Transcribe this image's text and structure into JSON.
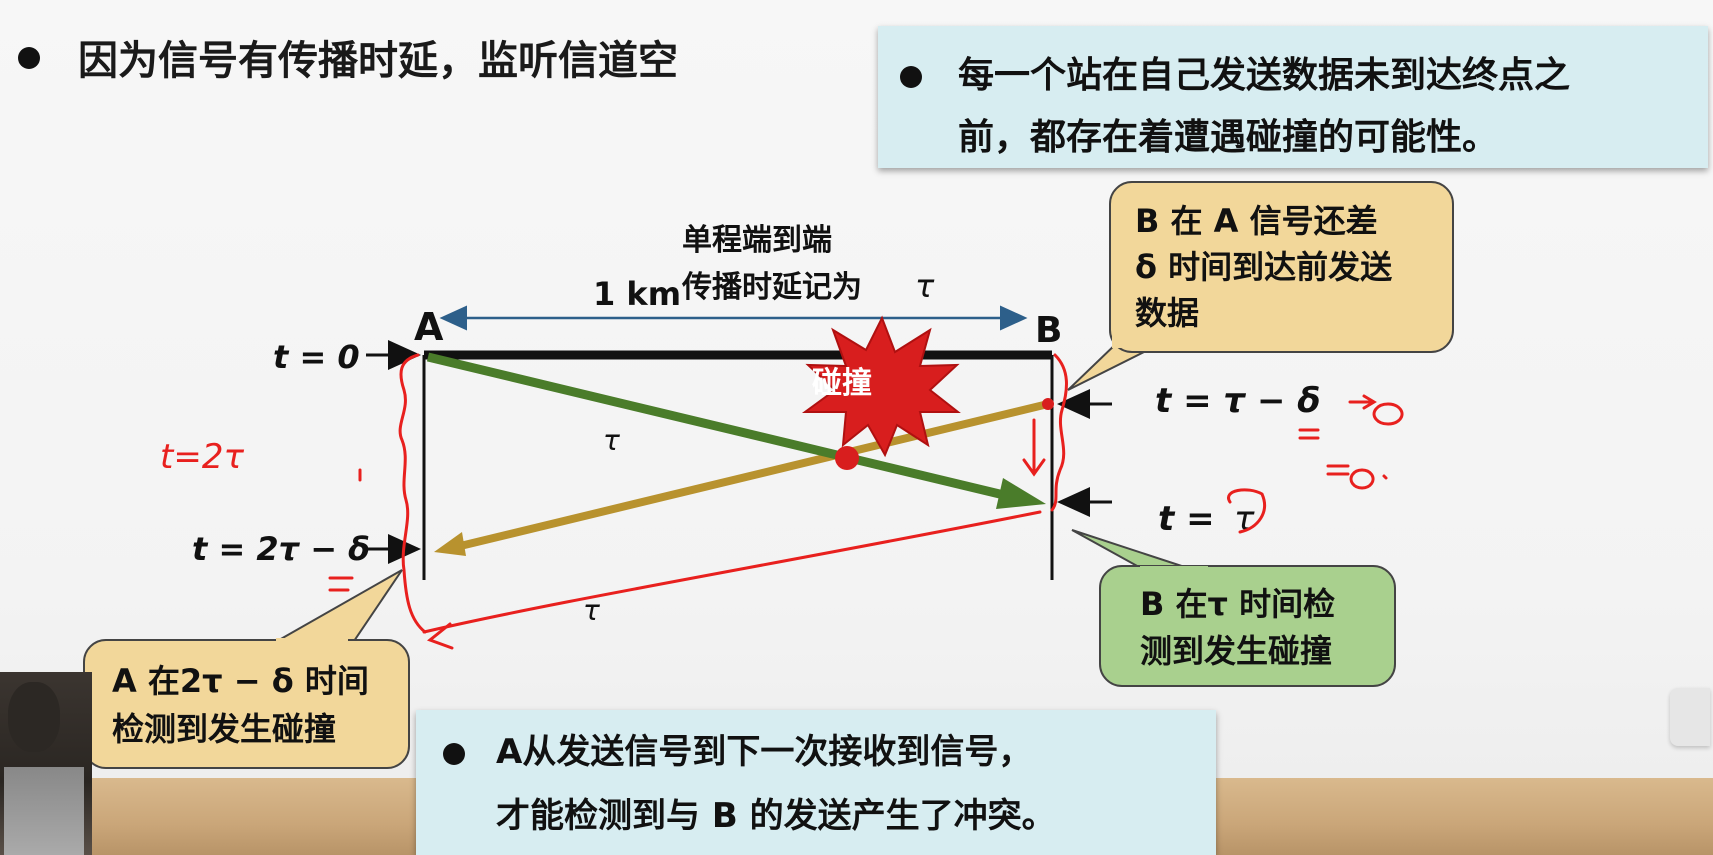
{
  "heading": "因为信号有传播时延，监听信道空",
  "top_note": {
    "line1": "每一个站在自己发送数据未到达终点之",
    "line2": "前，都存在着遭遇碰撞的可能性。"
  },
  "bottom_note": {
    "line1": "A从发送信号到下一次接收到信号，",
    "line2": "才能检测到与 B 的发送产生了冲突。"
  },
  "diagram": {
    "label_a": "A",
    "label_b": "B",
    "distance": "1 km",
    "delay_line1": "单程端到端",
    "delay_line2": "传播时延记为",
    "tau": "τ",
    "collision": "碰撞",
    "t0": "t = 0",
    "t_2tau_minus_delta": "t = 2τ − δ",
    "t_tau_minus_delta": "t = τ − δ",
    "t_tau_prefix": "t =",
    "callout_b_top": [
      "B 在 A 信号还差",
      "δ 时间到达前发送",
      "数据"
    ],
    "callout_b_bottom": [
      "B 在τ 时间检",
      "测到发生碰撞"
    ],
    "callout_a": [
      "A 在2τ − δ 时间",
      "检测到发生碰撞"
    ]
  },
  "colors": {
    "green_signal": "#4a7c2a",
    "gold_signal": "#b8922e",
    "collision_red": "#d81e1e",
    "callout_tan": "#f2d79a",
    "callout_green": "#a9d08e",
    "note_blue": "#d7edf1",
    "handwriting_red": "#e8201e"
  },
  "handwritten": {
    "t_eq_2tau": "t=2τ",
    "arrow_zero": "→0",
    "eq_zero": "=0.",
    "small_eq": "=0"
  }
}
